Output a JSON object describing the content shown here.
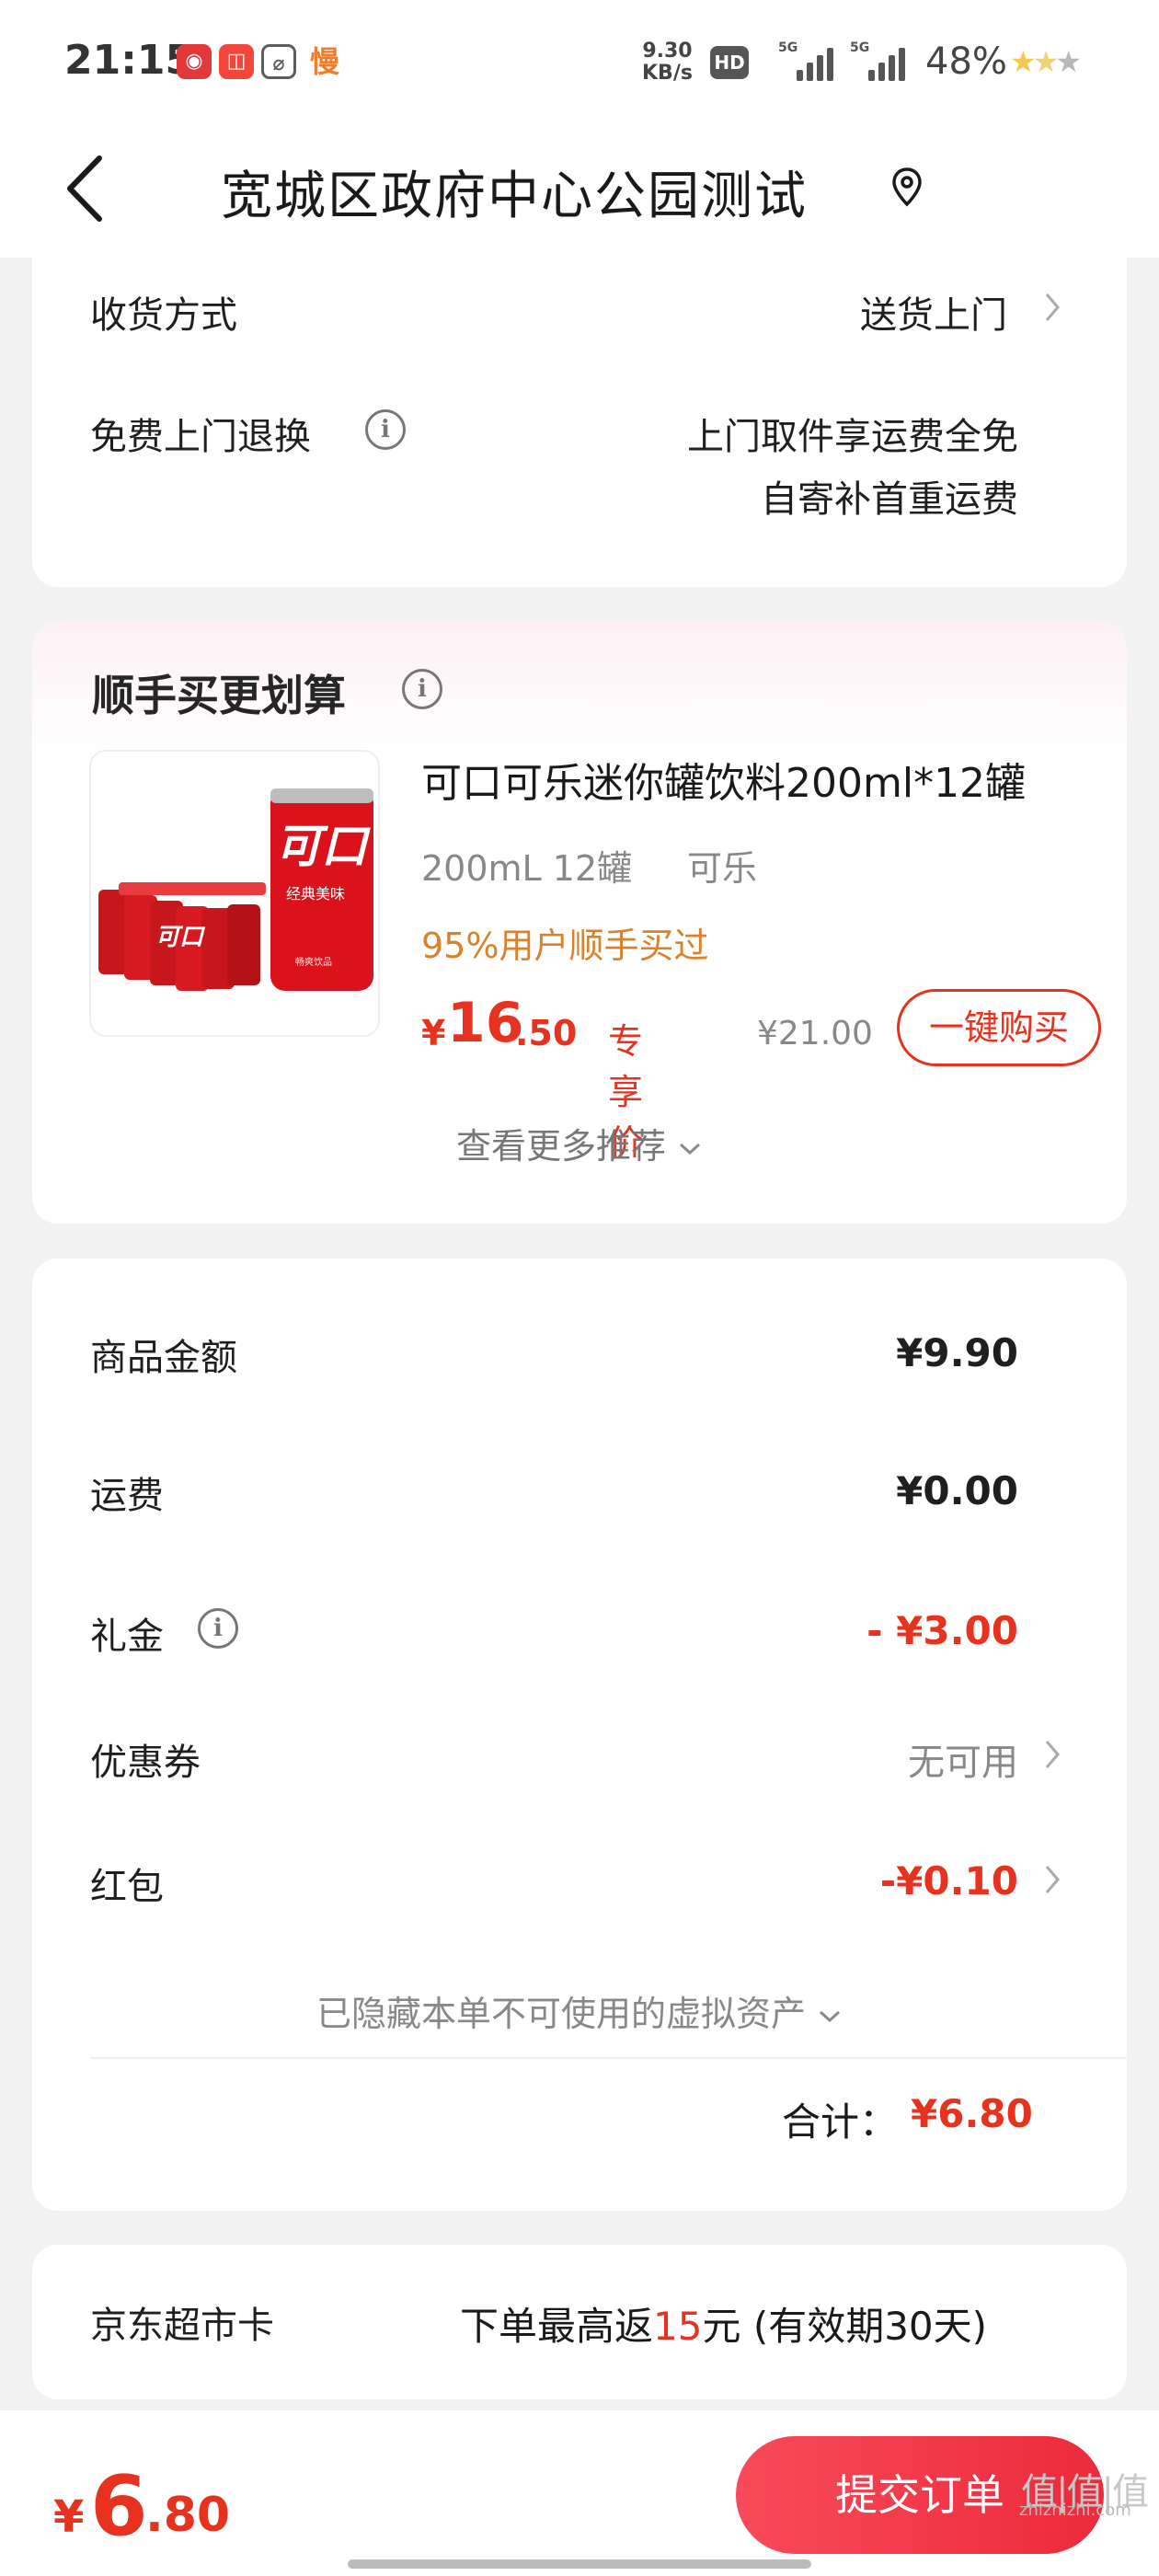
{
  "status_bar": {
    "time": "21:15",
    "app_icons": [
      {
        "glyph": "◉",
        "color": "#e2383a"
      },
      {
        "glyph": "◫",
        "color": "#f2463b"
      },
      {
        "glyph": "⌀",
        "color": "#5d5d5d"
      },
      {
        "glyph": "慢",
        "color": "#f27c2c"
      }
    ],
    "net_speed_value": "9.30",
    "net_speed_unit": "KB/s",
    "hd_label": "HD",
    "network_1": "5G",
    "network_2": "5G",
    "battery": "48%"
  },
  "header": {
    "title": "宽城区政府中心公园测试"
  },
  "delivery": {
    "method_label": "收货方式",
    "method_value": "送货上门",
    "return_label": "免费上门退换",
    "return_line1": "上门取件享运费全免",
    "return_line2": "自寄补首重运费"
  },
  "recommend": {
    "title": "顺手买更划算",
    "product": {
      "name": "可口可乐迷你罐饮料200ml*12罐",
      "spec": "200mL 12罐",
      "flavor": "可乐",
      "bought_ratio": "95%用户顺手买过",
      "price_yen": "¥",
      "price_int": "16",
      "price_dec": ".50",
      "price_tag": "专享价",
      "original_price": "¥21.00",
      "buy_label": "一键购买"
    },
    "more_label": "查看更多推荐"
  },
  "summary": {
    "rows": [
      {
        "label": "商品金额",
        "value": "¥9.90"
      },
      {
        "label": "运费",
        "value": "¥0.00"
      },
      {
        "label": "礼金",
        "value": "- ¥3.00"
      },
      {
        "label": "优惠券",
        "value": "无可用"
      },
      {
        "label": "红包",
        "value": "-¥0.10"
      }
    ],
    "hidden_assets": "已隐藏本单不可使用的虚拟资产",
    "total_label": "合计：",
    "total_value": "¥6.80"
  },
  "super_card": {
    "label": "京东超市卡",
    "desc_prefix": "下单最高返",
    "desc_amount": "15",
    "desc_suffix": "元 (有效期30天)"
  },
  "bottom": {
    "yen": "¥",
    "amount_int": "6",
    "amount_dec": ".80",
    "submit_label": "提交订单"
  },
  "watermark": {
    "big": "值|值|值",
    "small": "zhizhizhi.com"
  },
  "colors": {
    "accent_red": "#e6321e",
    "orange": "#d9822b",
    "submit_gradient_start": "#f84a5a",
    "submit_gradient_end": "#ec2a3b"
  }
}
